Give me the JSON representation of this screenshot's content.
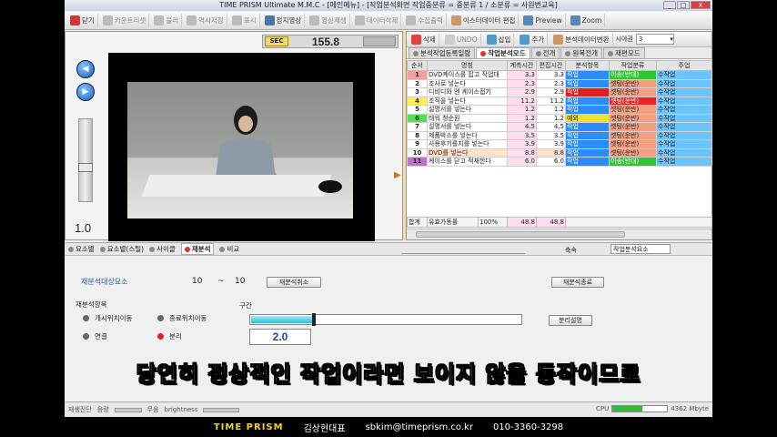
{
  "window": {
    "title": "TIME PRISM Ultimate M.M.C - [메인메뉴] - [작업분석화면 작업중분류 = 중분류 1 / 소분류 = 사원번교육]",
    "btn_min": "_",
    "btn_max": "□",
    "btn_close": "X"
  },
  "toolbar": [
    {
      "label": "닫기",
      "icon": "close-icon",
      "color": "#d33",
      "dim": false
    },
    {
      "label": "카운트리셋",
      "icon": "reset-icon",
      "color": "#bbb",
      "dim": true
    },
    {
      "label": "불러",
      "icon": "load-icon",
      "color": "#bbb",
      "dim": true
    },
    {
      "label": "역사저장",
      "icon": "save-icon",
      "color": "#bbb",
      "dim": true
    },
    {
      "label": "표시",
      "icon": "display-icon",
      "color": "#bbb",
      "dim": true
    },
    {
      "label": "정지영상",
      "icon": "still-image-icon",
      "color": "#47a",
      "dim": false
    },
    {
      "label": "영상재생",
      "icon": "play-video-icon",
      "color": "#bbb",
      "dim": true
    },
    {
      "label": "데이터삭제",
      "icon": "delete-data-icon",
      "color": "#bbb",
      "dim": true
    },
    {
      "label": "수집출력",
      "icon": "print-icon",
      "color": "#bbb",
      "dim": true
    },
    {
      "label": "이스터데이터 편집",
      "icon": "edit-data-icon",
      "color": "#c96",
      "dim": false
    },
    {
      "label": "Preview",
      "icon": "preview-icon",
      "color": "#58b",
      "dim": false
    },
    {
      "label": "Zoom",
      "icon": "zoom-icon",
      "color": "#58b",
      "dim": false
    }
  ],
  "timer": {
    "label": "SEC",
    "value": "155.8"
  },
  "playback": {
    "speed": "1.0",
    "prev_glyph": "◀",
    "play_glyph": "▶"
  },
  "right_toolbar": {
    "delete": "삭제",
    "undo": "UNDO",
    "insert": "삽입",
    "add": "추가",
    "analysis_data": "분석데이터변환",
    "sight_label": "시야권",
    "sight_value": "3"
  },
  "tabs": [
    {
      "label": "분석작업등록일람",
      "active": false
    },
    {
      "label": "작업분석모드",
      "active": true
    },
    {
      "label": "전개",
      "active": false
    },
    {
      "label": "원목전개",
      "active": false
    },
    {
      "label": "재편모드",
      "active": false
    }
  ],
  "grid": {
    "headers": [
      "순서",
      "명칭",
      "계측시간",
      "편집시간",
      "분석항목",
      "작업분류",
      "주업"
    ],
    "rows": [
      {
        "no": "1",
        "color": "#f4a0a0",
        "name": "DVD케이스를 잡고 작업대",
        "t1": "3.3",
        "t2": "3.3",
        "item": "작업",
        "item_color": "#2a8cff",
        "cls": "이송(반대)",
        "cls_color": "#31c631",
        "main": "수작업",
        "hl": false
      },
      {
        "no": "2",
        "color": "#ffffff",
        "name": "조사로 넣는다",
        "t1": "2.3",
        "t2": "2.3",
        "item": "작업",
        "item_color": "#2a8cff",
        "cls": "셋팅(운반)",
        "cls_color": "#f4a080",
        "main": "수작업",
        "hl": false
      },
      {
        "no": "3",
        "color": "#ffffff",
        "name": "디비디와 엔 케이스접기",
        "t1": "2.9",
        "t2": "2.9",
        "item": "작업",
        "item_color": "#e02020",
        "cls": "셋팅(운반)",
        "cls_color": "#f4a080",
        "main": "수작업",
        "hl": false
      },
      {
        "no": "4",
        "color": "#ffee55",
        "name": "조직을 넣는다",
        "t1": "11.2",
        "t2": "11.2",
        "item": "작업",
        "item_color": "#2a8cff",
        "cls": "셋팅(운반)",
        "cls_color": "#f02020",
        "main": "수작업",
        "hl": false
      },
      {
        "no": "5",
        "color": "#ffffff",
        "name": "설명서를 넣는다",
        "t1": "1.2",
        "t2": "1.2",
        "item": "작업",
        "item_color": "#2a8cff",
        "cls": "셋팅(운반)",
        "cls_color": "#f4a080",
        "main": "수작업",
        "hl": false
      },
      {
        "no": "6",
        "color": "#55dd55",
        "name": "태워 청순원",
        "t1": "1.2",
        "t2": "1.2",
        "item": "예외",
        "item_color": "#f0e030",
        "cls": "셋팅(운반)",
        "cls_color": "#f4a080",
        "main": "수작업",
        "hl": false
      },
      {
        "no": "7",
        "color": "#ffffff",
        "name": "설명서를 넣는다",
        "t1": "4.5",
        "t2": "4.5",
        "item": "작업",
        "item_color": "#2a8cff",
        "cls": "셋팅(운반)",
        "cls_color": "#f4a080",
        "main": "수작업",
        "hl": false
      },
      {
        "no": "8",
        "color": "#ffffff",
        "name": "제품박스를 넣는다",
        "t1": "3.5",
        "t2": "3.5",
        "item": "작업",
        "item_color": "#2a8cff",
        "cls": "셋팅(운반)",
        "cls_color": "#f4a080",
        "main": "수작업",
        "hl": false
      },
      {
        "no": "9",
        "color": "#ffffff",
        "name": "사용후기를지를 넣는다",
        "t1": "3.9",
        "t2": "3.9",
        "item": "작업",
        "item_color": "#2a8cff",
        "cls": "셋팅(운반)",
        "cls_color": "#f4a080",
        "main": "수작업",
        "hl": false
      },
      {
        "no": "10",
        "color": "#ffffff",
        "name": "DVD를 넣는다",
        "t1": "8.8",
        "t2": "8.8",
        "item": "작업",
        "item_color": "#2a8cff",
        "cls": "셋팅(운반)",
        "cls_color": "#f4a080",
        "main": "수작업",
        "hl": true
      },
      {
        "no": "11",
        "color": "#c070d0",
        "name": "케이스를 닫고 적재한다",
        "t1": "6.0",
        "t2": "6.0",
        "item": "작업",
        "item_color": "#2a8cff",
        "cls": "이송(반대)",
        "cls_color": "#31c631",
        "main": "수작업",
        "hl": false
      }
    ],
    "summary": {
      "label": "합계",
      "eff_label": "유효가동률",
      "eff_value": "100%",
      "t1": "48.8",
      "t2": "48.8"
    }
  },
  "lower": {
    "tabs": [
      "요소별",
      "요소별(스틸)",
      "사이클",
      "재분석",
      "비교"
    ],
    "active_tab": "재분석",
    "mode_combo": "작업분석요소",
    "zoom_label": "축속",
    "target_label": "재분석대상요소",
    "range_from": "10",
    "range_sep": "~",
    "range_to": "10",
    "cancel_btn": "재분석취소",
    "finish_btn": "재분석종료",
    "group_label": "재분석항목",
    "opt_start": "개시위치이동",
    "opt_end": "종료위치이동",
    "opt_join": "연결",
    "opt_split": "분리",
    "section_label": "구간",
    "split_btn": "분리설명",
    "progress": 0.23,
    "value": "2.0"
  },
  "subtitle": "당연히 정상적인 작업이라면 보이지 않을 동작이므로",
  "status": {
    "left": "재생진단",
    "vol": "음량",
    "mute": "무음",
    "bright": "brightness",
    "cpu": "CPU",
    "cpu_load": 0.55,
    "mem": "4362 Mbyte"
  },
  "footer": {
    "brand": "TIME PRISM",
    "person": "김상현대표",
    "email": "sbkim@timeprism.co.kr",
    "phone": "010-3360-3298"
  }
}
